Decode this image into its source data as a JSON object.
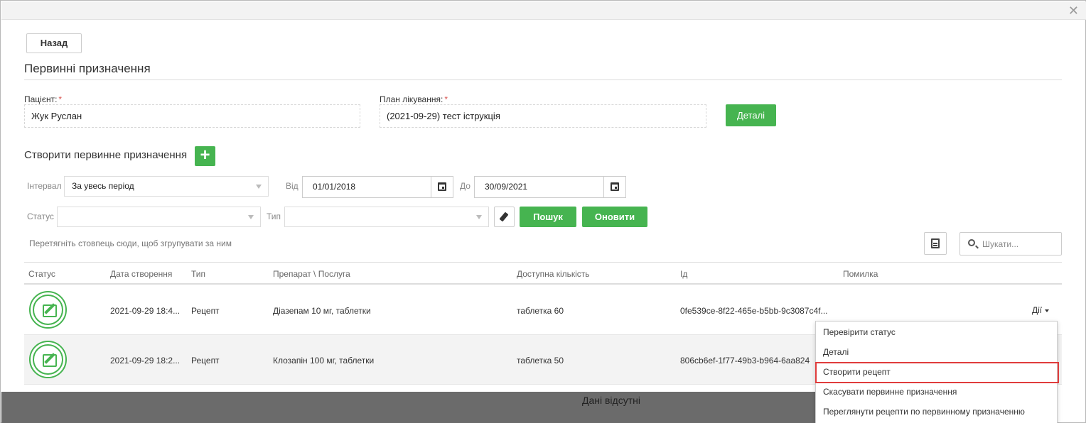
{
  "header": {
    "close_glyph": "✕"
  },
  "back_label": "Назад",
  "section_title": "Первинні призначення",
  "patient": {
    "label": "Пацієнт:",
    "required_mark": "*",
    "value": "Жук Руслан"
  },
  "plan": {
    "label": "План лікування:",
    "required_mark": "*",
    "value": "(2021-09-29) тест іструкція"
  },
  "details_label": "Деталі",
  "create": {
    "label": "Створити первинне призначення",
    "plus_glyph": "+"
  },
  "filters": {
    "interval_label": "Інтервал",
    "interval_value": "За увесь період",
    "from_label": "Від",
    "from_value": "01/01/2018",
    "to_label": "До",
    "to_value": "30/09/2021",
    "status_label": "Статус",
    "status_value": "",
    "type_label": "Тип",
    "type_value": "",
    "search_label": "Пошук",
    "refresh_label": "Оновити"
  },
  "grid": {
    "group_hint": "Перетягніть стовпець сюди, щоб згрупувати за ним",
    "search_placeholder": "Шукати...",
    "columns": [
      "Статус",
      "Дата створення",
      "Тип",
      "Препарат \\ Послуга",
      "Доступна кількість",
      "Ід",
      "Помилка"
    ],
    "rows": [
      {
        "status_icon": "edit-icon",
        "date": "2021-09-29 18:4...",
        "type": "Рецепт",
        "drug": "Діазепам 10 мг, таблетки",
        "qty": "таблетка 60",
        "id": "0fe539ce-8f22-465e-b5bb-9c3087c4f...",
        "error": ""
      },
      {
        "status_icon": "edit-icon",
        "date": "2021-09-29 18:2...",
        "type": "Рецепт",
        "drug": "Клозапін 100 мг, таблетки",
        "qty": "таблетка 50",
        "id": "806cb6ef-1f77-49b3-b964-6aa824",
        "error": ""
      }
    ],
    "actions_label": "Дії",
    "no_data": "Дані відсутні"
  },
  "actions_menu": {
    "items": [
      "Перевірити статус",
      "Деталі",
      "Створити рецепт",
      "Скасувати первинне призначення",
      "Переглянути рецепти по первинному призначенню"
    ],
    "highlighted_index": 2,
    "highlight_color": "#e03c3c"
  },
  "colors": {
    "accent_green": "#46b450",
    "required_red": "#d9534f"
  }
}
